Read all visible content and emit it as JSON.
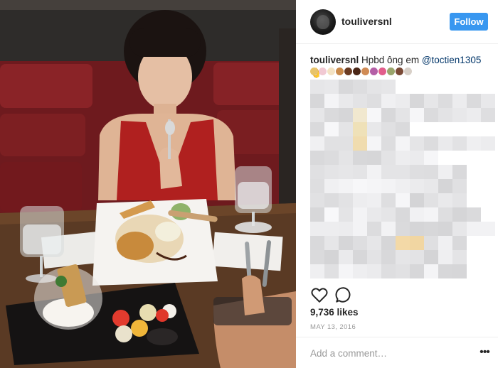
{
  "post": {
    "username": "touliversnl",
    "follow_label": "Follow",
    "caption": {
      "username": "touliversnl",
      "text": " Hpbd ông em ",
      "mention": "@toctien1305",
      "trailing_emoji": "👌"
    },
    "caption_emojis": [
      "cupcake",
      "cake",
      "birthday-cake",
      "cake",
      "donut",
      "chocolate",
      "donut",
      "candy",
      "lollipop",
      "ice-cream",
      "popsicle",
      "sundae"
    ],
    "likes": "9,736 likes",
    "date": "MAY 13, 2016",
    "comment_placeholder": "Add a comment…",
    "more_label": "•••"
  },
  "photo_description_colors": {
    "booth": "#7d1f22",
    "dress": "#b0201f",
    "table": "#5a3a24"
  }
}
